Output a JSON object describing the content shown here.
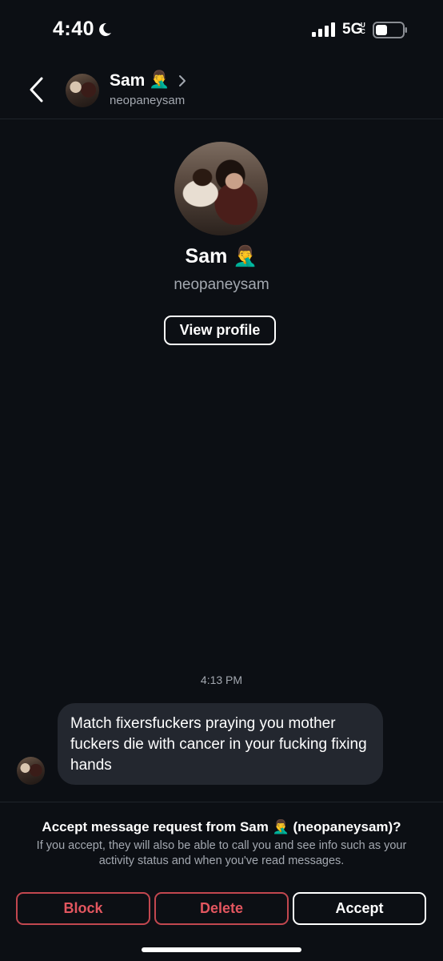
{
  "status_bar": {
    "time": "4:40",
    "network": "5G",
    "network_sub": "UC"
  },
  "header": {
    "name": "Sam",
    "emoji": "🤦‍♂️",
    "username": "neopaneysam"
  },
  "profile": {
    "name": "Sam 🤦‍♂️",
    "username": "neopaneysam",
    "view_profile_label": "View profile"
  },
  "conversation": {
    "timestamp": "4:13 PM",
    "message": "Match fixersfuckers praying you mother fuckers die with cancer in your fucking fixing hands"
  },
  "request": {
    "title": "Accept message request from Sam 🤦‍♂️ (neopaneysam)?",
    "description": "If you accept, they will also be able to call you and see info such as your activity status and when you've read messages."
  },
  "actions": {
    "block": "Block",
    "delete": "Delete",
    "accept": "Accept"
  },
  "colors": {
    "background": "#0c0f14",
    "bubble": "#23272f",
    "danger": "#e2565f",
    "secondary_text": "#a3a8b0"
  }
}
